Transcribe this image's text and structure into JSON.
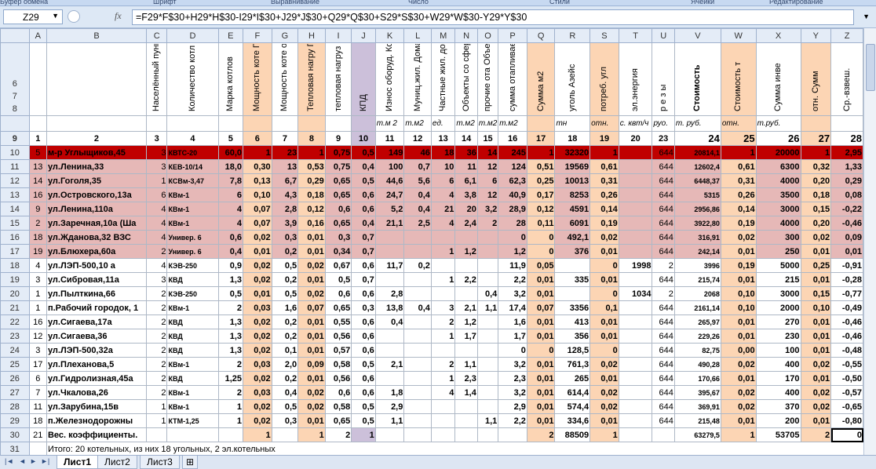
{
  "ribbon": [
    "Буфер обмена",
    "Шрифт",
    "Выравнивание",
    "Число",
    "Стили",
    "Ячейки",
    "Редактирование"
  ],
  "namebox": "Z29",
  "fx": "fx",
  "formula": "=F29*F$30+H29*H$30-I29*I$30+J29*J$30+Q29*Q$30+S29*S$30+W29*W$30-Y29*Y$30",
  "columns": [
    "A",
    "B",
    "C",
    "D",
    "E",
    "F",
    "G",
    "H",
    "I",
    "J",
    "K",
    "L",
    "M",
    "N",
    "O",
    "P",
    "Q",
    "R",
    "S",
    "T",
    "U",
    "V",
    "W",
    "X",
    "Y",
    "Z"
  ],
  "header_rows": [
    "6",
    "7",
    "8"
  ],
  "header": [
    "",
    "Населённый пункт,адрес кот",
    "Количество котл",
    "Марка котлов",
    "Мощность коте Гкал/ч",
    "Мощность коте отн.",
    "Тепловая нагру Гкал/ч",
    "тепловая нагруз",
    "КПД",
    "Износ оборуд. Котельной %",
    "Муниц.жил. Дома",
    "Частные жил. дома",
    "Объекты со сферы",
    "прочие ота Объекты",
    "сумма отапливаем",
    "Сумма м2",
    "уголь Азейс",
    "потреб. угл",
    "эл.энергия",
    "р е з ы",
    "Стоимость",
    "Стоимость т",
    "Сумма инве",
    "отн. Сумм",
    "Ср.-взвеш."
  ],
  "header_bold_index": 20,
  "units_row": "9",
  "units": [
    "",
    "",
    "",
    "",
    "",
    "",
    "",
    "",
    "",
    "",
    "т.м 2",
    "т.м2",
    "ед.",
    "т.м2",
    "т.м2",
    "т.м2",
    "",
    "тн",
    "отн.",
    "с. квт/ч",
    "руо.",
    "т. руб.",
    "отн.",
    "т.руб.",
    "",
    ""
  ],
  "nums_row": "9",
  "nums": [
    "1",
    "2",
    "3",
    "4",
    "5",
    "6",
    "7",
    "8",
    "9",
    "10",
    "11",
    "12",
    "13",
    "14",
    "15",
    "16",
    "17",
    "18",
    "19",
    "20",
    "23",
    "24",
    "25",
    "26",
    "27",
    "28"
  ],
  "rows": [
    {
      "r": "10",
      "s": "red",
      "c": [
        "5",
        "м-р Углыщиков,45",
        "3",
        "КВТС-20",
        "60,0",
        "1",
        "23",
        "1",
        "0,75",
        "0,5",
        "149",
        "46",
        "18",
        "36",
        "14",
        "245",
        "1",
        "32320",
        "1",
        "",
        "644",
        "20814,1",
        "1",
        "20000",
        "1",
        "2,95"
      ]
    },
    {
      "r": "11",
      "s": "pink",
      "c": [
        "13",
        "ул.Ленина,33",
        "3",
        "КЕВ-10/14",
        "18,0",
        "0,30",
        "13",
        "0,53",
        "0,75",
        "0,4",
        "100",
        "0,7",
        "10",
        "11",
        "12",
        "124",
        "0,51",
        "19569",
        "0,61",
        "",
        "644",
        "12602,4",
        "0,61",
        "6300",
        "0,32",
        "1,33"
      ]
    },
    {
      "r": "12",
      "s": "pink",
      "c": [
        "14",
        "ул.Гоголя,35",
        "1",
        "КСВм-3,47",
        "7,8",
        "0,13",
        "6,7",
        "0,29",
        "0,65",
        "0,5",
        "44,6",
        "5,6",
        "6",
        "6,1",
        "6",
        "62,3",
        "0,25",
        "10013",
        "0,31",
        "",
        "644",
        "6448,37",
        "0,31",
        "4000",
        "0,20",
        "0,29"
      ]
    },
    {
      "r": "13",
      "s": "pink",
      "c": [
        "16",
        "ул.Островского,13а",
        "6",
        "КВм-1",
        "6",
        "0,10",
        "4,3",
        "0,18",
        "0,65",
        "0,6",
        "24,7",
        "0,4",
        "4",
        "3,8",
        "12",
        "40,9",
        "0,17",
        "8253",
        "0,26",
        "",
        "644",
        "5315",
        "0,26",
        "3500",
        "0,18",
        "0,08"
      ]
    },
    {
      "r": "14",
      "s": "pink",
      "c": [
        "9",
        "ул.Ленина,110а",
        "4",
        "КВм-1",
        "4",
        "0,07",
        "2,8",
        "0,12",
        "0,6",
        "0,6",
        "5,2",
        "0,4",
        "21",
        "20",
        "3,2",
        "28,9",
        "0,12",
        "4591",
        "0,14",
        "",
        "644",
        "2956,86",
        "0,14",
        "3000",
        "0,15",
        "-0,22"
      ]
    },
    {
      "r": "15",
      "s": "pink",
      "c": [
        "2",
        "ул.Заречная,10а (Ша",
        "4",
        "КВм-1",
        "4",
        "0,07",
        "3,9",
        "0,16",
        "0,65",
        "0,4",
        "21,1",
        "2,5",
        "4",
        "2,4",
        "2",
        "28",
        "0,11",
        "6091",
        "0,19",
        "",
        "644",
        "3922,80",
        "0,19",
        "4000",
        "0,20",
        "-0,46"
      ]
    },
    {
      "r": "16",
      "s": "pink",
      "c": [
        "18",
        "ул.Жданова,32 ВЗС",
        "4",
        "Универ. 6",
        "0,6",
        "0,02",
        "0,3",
        "0,01",
        "0,3",
        "0,7",
        "",
        "",
        "",
        "",
        "",
        "0",
        "0",
        "492,1",
        "0,02",
        "",
        "644",
        "316,91",
        "0,02",
        "300",
        "0,02",
        "0,09"
      ]
    },
    {
      "r": "17",
      "s": "pink",
      "c": [
        "19",
        "ул.Блюхера,60а",
        "2",
        "Универ. 6",
        "0,4",
        "0,01",
        "0,2",
        "0,01",
        "0,34",
        "0,7",
        "",
        "",
        "1",
        "1,2",
        "",
        "1,2",
        "0",
        "376",
        "0,01",
        "",
        "644",
        "242,14",
        "0,01",
        "250",
        "0,01",
        "0,01"
      ]
    },
    {
      "r": "18",
      "s": "",
      "c": [
        "4",
        "ул.ЛЭП-500,10 а",
        "4",
        "КЭВ-250",
        "0,9",
        "0,02",
        "0,5",
        "0,02",
        "0,67",
        "0,6",
        "11,7",
        "0,2",
        "",
        "",
        "",
        "11,9",
        "0,05",
        "",
        "0",
        "1998",
        "2",
        "3996",
        "0,19",
        "5000",
        "0,25",
        "-0,91"
      ]
    },
    {
      "r": "19",
      "s": "",
      "c": [
        "3",
        "ул.Сибровая,11а",
        "3",
        "КВД",
        "1,3",
        "0,02",
        "0,2",
        "0,01",
        "0,5",
        "0,7",
        "",
        "",
        "1",
        "2,2",
        "",
        "2,2",
        "0,01",
        "335",
        "0,01",
        "",
        "644",
        "215,74",
        "0,01",
        "215",
        "0,01",
        "-0,28"
      ]
    },
    {
      "r": "20",
      "s": "",
      "c": [
        "1",
        "ул.Пылткина,66",
        "2",
        "КЭВ-250",
        "0,5",
        "0,01",
        "0,5",
        "0,02",
        "0,6",
        "0,6",
        "2,8",
        "",
        "",
        "",
        "0,4",
        "3,2",
        "0,01",
        "",
        "0",
        "1034",
        "2",
        "2068",
        "0,10",
        "3000",
        "0,15",
        "-0,77"
      ]
    },
    {
      "r": "21",
      "s": "",
      "c": [
        "1",
        "п.Рабочий городок, 1",
        "2",
        "КВм-1",
        "2",
        "0,03",
        "1,6",
        "0,07",
        "0,65",
        "0,3",
        "13,8",
        "0,4",
        "3",
        "2,1",
        "1,1",
        "17,4",
        "0,07",
        "3356",
        "0,1",
        "",
        "644",
        "2161,14",
        "0,10",
        "2000",
        "0,10",
        "-0,49"
      ]
    },
    {
      "r": "22",
      "s": "",
      "c": [
        "16",
        "ул.Сигаева,17а",
        "2",
        "КВД",
        "1,3",
        "0,02",
        "0,2",
        "0,01",
        "0,55",
        "0,6",
        "0,4",
        "",
        "2",
        "1,2",
        "",
        "1,6",
        "0,01",
        "413",
        "0,01",
        "",
        "644",
        "265,97",
        "0,01",
        "270",
        "0,01",
        "-0,46"
      ]
    },
    {
      "r": "23",
      "s": "",
      "c": [
        "12",
        "ул.Сигаева,36",
        "2",
        "КВД",
        "1,3",
        "0,02",
        "0,2",
        "0,01",
        "0,56",
        "0,6",
        "",
        "",
        "1",
        "1,7",
        "",
        "1,7",
        "0,01",
        "356",
        "0,01",
        "",
        "644",
        "229,26",
        "0,01",
        "230",
        "0,01",
        "-0,46"
      ]
    },
    {
      "r": "24",
      "s": "",
      "c": [
        "3",
        "ул.ЛЭП-500,32а",
        "2",
        "КВД",
        "1,3",
        "0,02",
        "0,1",
        "0,01",
        "0,57",
        "0,6",
        "",
        "",
        "",
        "",
        "",
        "0",
        "0",
        "128,5",
        "0",
        "",
        "644",
        "82,75",
        "0,00",
        "100",
        "0,01",
        "-0,48"
      ]
    },
    {
      "r": "25",
      "s": "",
      "c": [
        "17",
        "ул.Плеханова,5",
        "2",
        "КВм-1",
        "2",
        "0,03",
        "2,0",
        "0,09",
        "0,58",
        "0,5",
        "2,1",
        "",
        "2",
        "1,1",
        "",
        "3,2",
        "0,01",
        "761,3",
        "0,02",
        "",
        "644",
        "490,28",
        "0,02",
        "400",
        "0,02",
        "-0,55"
      ]
    },
    {
      "r": "26",
      "s": "",
      "c": [
        "6",
        "ул.Гидролизная,45а",
        "2",
        "КВД",
        "1,25",
        "0,02",
        "0,2",
        "0,01",
        "0,56",
        "0,6",
        "",
        "",
        "1",
        "2,3",
        "",
        "2,3",
        "0,01",
        "265",
        "0,01",
        "",
        "644",
        "170,66",
        "0,01",
        "170",
        "0,01",
        "-0,50"
      ]
    },
    {
      "r": "27",
      "s": "",
      "c": [
        "7",
        "ул.Чкалова,26",
        "2",
        "КВм-1",
        "2",
        "0,03",
        "0,4",
        "0,02",
        "0,6",
        "0,6",
        "1,8",
        "",
        "4",
        "1,4",
        "",
        "3,2",
        "0,01",
        "614,4",
        "0,02",
        "",
        "644",
        "395,67",
        "0,02",
        "400",
        "0,02",
        "-0,57"
      ]
    },
    {
      "r": "28",
      "s": "",
      "c": [
        "11",
        "ул.Зарубина,15в",
        "1",
        "КВм-1",
        "1",
        "0,02",
        "0,5",
        "0,02",
        "0,58",
        "0,5",
        "2,9",
        "",
        "",
        "",
        "",
        "2,9",
        "0,01",
        "574,4",
        "0,02",
        "",
        "644",
        "369,91",
        "0,02",
        "370",
        "0,02",
        "-0,65"
      ]
    },
    {
      "r": "29",
      "s": "",
      "c": [
        "18",
        "п.Железнодорожны",
        "1",
        "КТМ-1,25",
        "1",
        "0,02",
        "0,3",
        "0,01",
        "0,65",
        "0,5",
        "1,1",
        "",
        "",
        "",
        "1,1",
        "2,2",
        "0,01",
        "334,6",
        "0,01",
        "",
        "644",
        "215,48",
        "0,01",
        "200",
        "0,01",
        "-0,80"
      ]
    },
    {
      "r": "30",
      "s": "coef",
      "c": [
        "21",
        "Вес. коэффициенты.",
        "",
        "",
        "",
        "1",
        "",
        "1",
        "2",
        "1",
        "",
        "",
        "",
        "",
        "",
        "",
        "2",
        "88509",
        "1",
        "",
        "",
        "63279,5",
        "1",
        "53705",
        "2",
        "0"
      ]
    }
  ],
  "row31": {
    "r": "31",
    "text": "Итого: 20 котельных, из них 18 угольных, 2 эл.котельных"
  },
  "row32": {
    "r": "32"
  },
  "tabs": [
    "Лист1",
    "Лист2",
    "Лист3"
  ],
  "colors": {
    "red": "#c00000",
    "pink": "#e6b8b7",
    "peach": "#fcd5b4",
    "lavender": "#ccc0da"
  }
}
